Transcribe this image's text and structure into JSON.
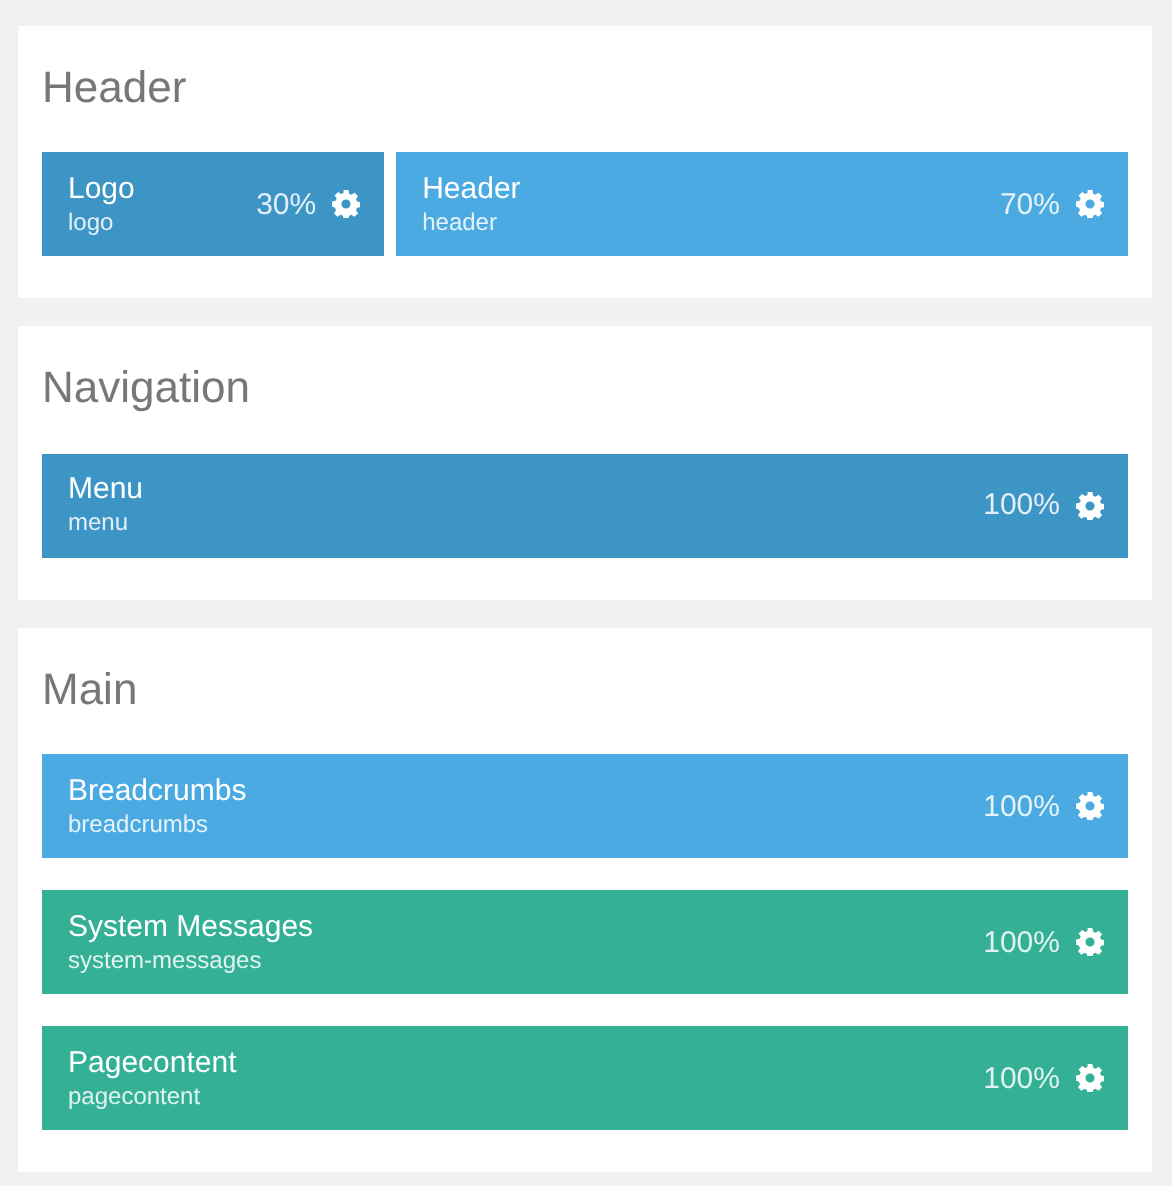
{
  "sections": [
    {
      "title": "Header",
      "rows": [
        [
          {
            "name": "Logo",
            "id_text": "logo",
            "percent": "30%",
            "color": "#3d95c6"
          },
          {
            "name": "Header",
            "id_text": "header",
            "percent": "70%",
            "color": "#4aaae1"
          }
        ]
      ]
    },
    {
      "title": "Navigation",
      "rows": [
        [
          {
            "name": "Menu",
            "id_text": "menu",
            "percent": "100%",
            "color": "#3d95c6"
          }
        ]
      ]
    },
    {
      "title": "Main",
      "rows": [
        [
          {
            "name": "Breadcrumbs",
            "id_text": "breadcrumbs",
            "percent": "100%",
            "color": "#4aaae1"
          }
        ],
        [
          {
            "name": "System Messages",
            "id_text": "system-messages",
            "percent": "100%",
            "color": "#33b096"
          }
        ],
        [
          {
            "name": "Pagecontent",
            "id_text": "pagecontent",
            "percent": "100%",
            "color": "#33b096"
          }
        ]
      ]
    }
  ]
}
